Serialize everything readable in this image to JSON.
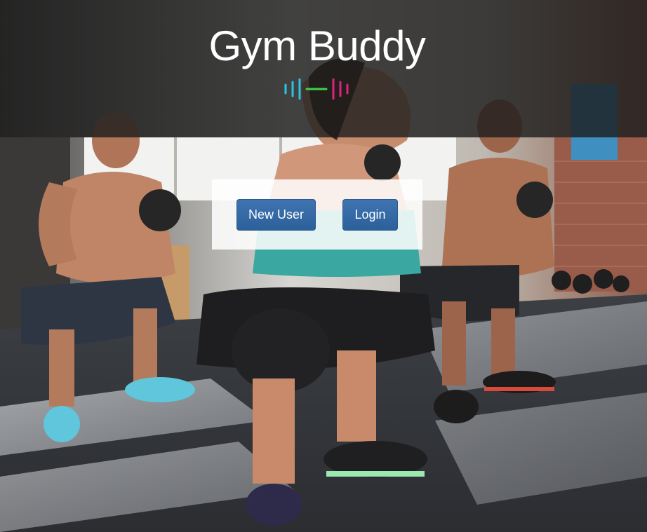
{
  "header": {
    "title": "Gym Buddy",
    "logo_icon": "equalizer-wave-icon",
    "logo_colors": [
      "#29c4e6",
      "#3fd24a",
      "#e0237a"
    ]
  },
  "auth": {
    "new_user_label": "New User",
    "login_label": "Login",
    "button_color": "#3268a5"
  },
  "background": {
    "image": "fitness-class-kettlebell-squat-photo"
  }
}
